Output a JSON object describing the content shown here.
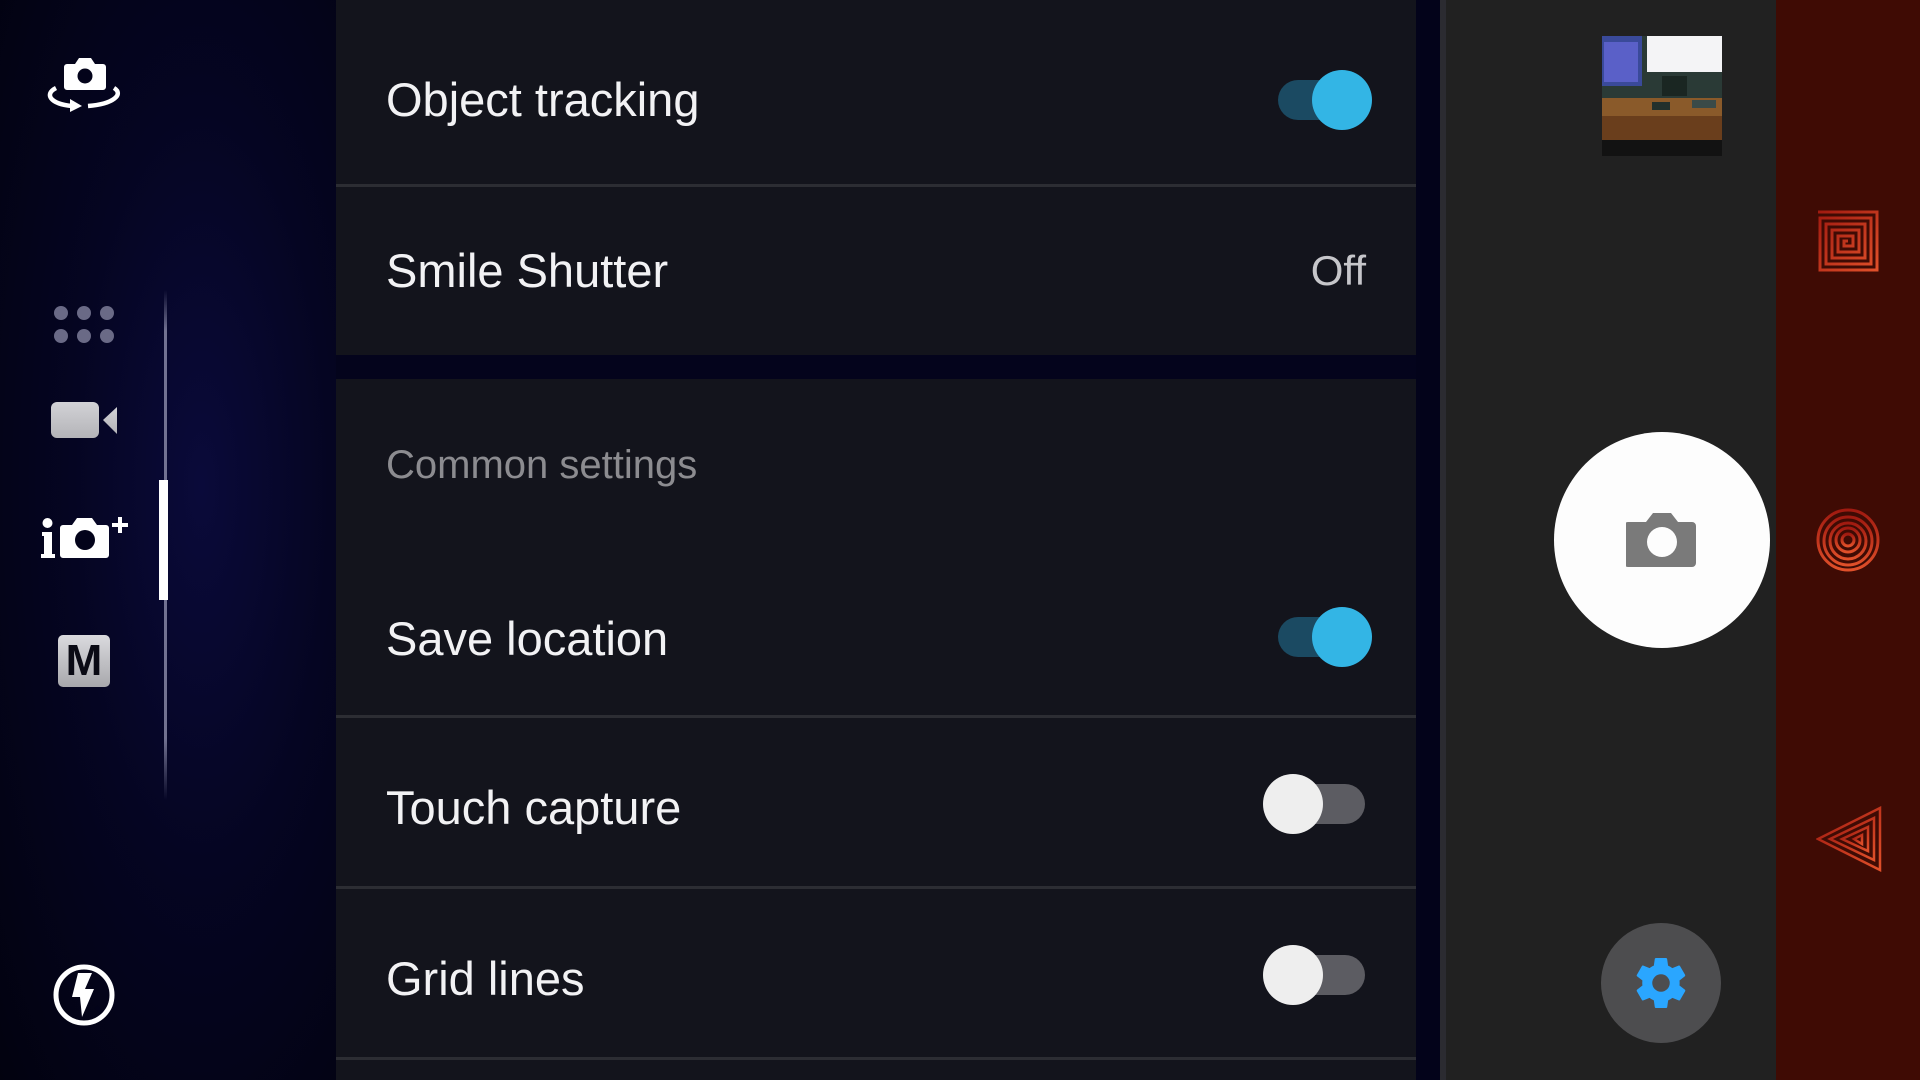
{
  "sidebar": {
    "switch_camera_icon": "camera-switch-icon",
    "modes": [
      {
        "name": "more-modes",
        "icon": "grid-dots-icon",
        "active": false
      },
      {
        "name": "video",
        "icon": "video-camera-icon",
        "active": false
      },
      {
        "name": "superior-auto",
        "icon": "superior-auto-icon",
        "active": true
      },
      {
        "name": "manual",
        "icon": "manual-mode-icon",
        "label": "M",
        "active": false
      }
    ],
    "flash_icon": "flash-auto-icon"
  },
  "settings": {
    "group1": [
      {
        "label": "Object tracking",
        "type": "toggle",
        "value": true
      },
      {
        "label": "Smile Shutter",
        "type": "value",
        "value": "Off"
      }
    ],
    "section_header": "Common settings",
    "group2": [
      {
        "label": "Save location",
        "type": "toggle",
        "value": true
      },
      {
        "label": "Touch capture",
        "type": "toggle",
        "value": false
      },
      {
        "label": "Grid lines",
        "type": "toggle",
        "value": false
      }
    ]
  },
  "controls": {
    "thumbnail_icon": "last-photo-thumbnail",
    "shutter_icon": "camera-icon",
    "settings_icon": "gear-icon"
  },
  "navbar": {
    "items": [
      {
        "name": "recent-apps",
        "icon": "square-spiral-icon"
      },
      {
        "name": "home",
        "icon": "circle-spiral-icon"
      },
      {
        "name": "back",
        "icon": "triangle-spiral-icon"
      }
    ]
  },
  "colors": {
    "accent": "#33b5e5",
    "toggle_on_track": "#1b4a62",
    "toggle_off_thumb": "#eeeeee",
    "panel_bg": "#13141c",
    "navbar_bg": "#3f0b04",
    "controls_bg": "#212121"
  }
}
